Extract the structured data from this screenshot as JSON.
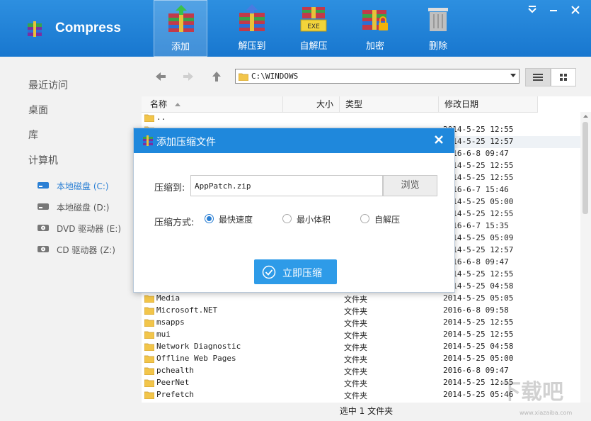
{
  "app": {
    "title": "Compress"
  },
  "toolbar": [
    {
      "label": "添加",
      "icon": "add-archive-icon",
      "active": true
    },
    {
      "label": "解压到",
      "icon": "extract-to-icon",
      "active": false
    },
    {
      "label": "自解压",
      "icon": "self-extract-exe-icon",
      "active": false
    },
    {
      "label": "加密",
      "icon": "encrypt-lock-icon",
      "active": false
    },
    {
      "label": "删除",
      "icon": "trash-icon",
      "active": false
    }
  ],
  "window_controls": {
    "menu": "menu-icon",
    "minimize": "minimize-icon",
    "close": "close-icon"
  },
  "sidebar": {
    "items": [
      "最近访问",
      "桌面",
      "库",
      "计算机"
    ],
    "drives": [
      {
        "label": "本地磁盘 (C:)",
        "selected": true
      },
      {
        "label": "本地磁盘 (D:)",
        "selected": false
      },
      {
        "label": "DVD 驱动器 (E:)",
        "selected": false
      },
      {
        "label": "CD 驱动器 (Z:)",
        "selected": false
      }
    ]
  },
  "address": {
    "path": "C:\\WINDOWS"
  },
  "columns": {
    "name": "名称",
    "size": "大小",
    "type": "类型",
    "date": "修改日期"
  },
  "rows": [
    {
      "name": "..",
      "type": "",
      "date": ""
    },
    {
      "name": "",
      "type": "",
      "date": "2014-5-25 12:55"
    },
    {
      "name": "",
      "type": "",
      "date": "2014-5-25 12:57"
    },
    {
      "name": "",
      "type": "",
      "date": "2016-6-8 09:47"
    },
    {
      "name": "",
      "type": "",
      "date": "2014-5-25 12:55"
    },
    {
      "name": "",
      "type": "",
      "date": "2014-5-25 12:55"
    },
    {
      "name": "",
      "type": "",
      "date": "2016-6-7 15:46"
    },
    {
      "name": "",
      "type": "",
      "date": "2014-5-25 05:00"
    },
    {
      "name": "",
      "type": "",
      "date": "2014-5-25 12:55"
    },
    {
      "name": "",
      "type": "",
      "date": "2016-6-7 15:35"
    },
    {
      "name": "",
      "type": "",
      "date": "2014-5-25 05:09"
    },
    {
      "name": "",
      "type": "",
      "date": "2014-5-25 12:57"
    },
    {
      "name": "",
      "type": "",
      "date": "2016-6-8 09:47"
    },
    {
      "name": "",
      "type": "",
      "date": "2014-5-25 12:55"
    },
    {
      "name": "",
      "type": "",
      "date": "2014-5-25 04:58"
    },
    {
      "name": "Media",
      "type": "文件夹",
      "date": "2014-5-25 05:05"
    },
    {
      "name": "Microsoft.NET",
      "type": "文件夹",
      "date": "2016-6-8 09:58"
    },
    {
      "name": "msapps",
      "type": "文件夹",
      "date": "2014-5-25 12:55"
    },
    {
      "name": "mui",
      "type": "文件夹",
      "date": "2014-5-25 12:55"
    },
    {
      "name": "Network Diagnostic",
      "type": "文件夹",
      "date": "2014-5-25 04:58"
    },
    {
      "name": "Offline Web Pages",
      "type": "文件夹",
      "date": "2014-5-25 05:00"
    },
    {
      "name": "pchealth",
      "type": "文件夹",
      "date": "2016-6-8 09:47"
    },
    {
      "name": "PeerNet",
      "type": "文件夹",
      "date": "2014-5-25 12:55"
    },
    {
      "name": "Prefetch",
      "type": "文件夹",
      "date": "2014-5-25 05:46"
    }
  ],
  "status": "选中 1 文件夹",
  "dialog": {
    "title": "添加压缩文件",
    "dest_label": "压缩到:",
    "dest_value": "AppPatch.zip",
    "browse": "浏览",
    "method_label": "压缩方式:",
    "options": [
      {
        "label": "最快速度",
        "selected": true
      },
      {
        "label": "最小体积",
        "selected": false
      },
      {
        "label": "自解压",
        "selected": false
      }
    ],
    "submit": "立即压缩"
  },
  "watermark": {
    "text": "下载吧",
    "url": "www.xiazaiba.com"
  },
  "colors": {
    "accent": "#1f88dc",
    "toolbar": "#1877cf",
    "sidebar_bg": "#f2f2f2",
    "selected": "#2a7fd4"
  }
}
